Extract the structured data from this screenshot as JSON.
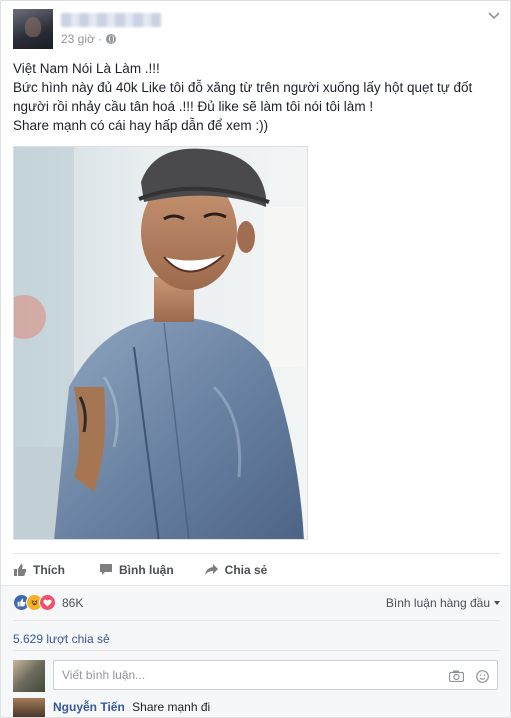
{
  "post": {
    "timestamp": "23 giờ ·",
    "lines": [
      "Việt Nam Nói Là Làm .!!!",
      "Bức hình này đủ 40k Like tôi đỗ xăng từ trên người xuống lấy hột quẹt tự đốt",
      "người rồi nhảy cầu tân hoá .!!! Đủ like sẽ làm tôi nói tôi làm !",
      "Share mạnh có cái hay hấp dẫn để xem :))"
    ]
  },
  "actions": {
    "like": "Thích",
    "comment": "Bình luận",
    "share": "Chia sẻ"
  },
  "reactions": {
    "count": "86K",
    "top_comments": "Bình luận hàng đầu",
    "shares": "5.629 lượt chia sẻ"
  },
  "comment_input": {
    "placeholder": "Viết bình luận..."
  },
  "comments": [
    {
      "author": "Nguyễn Tiến",
      "text": "Share mạnh đi"
    }
  ],
  "colors": {
    "link": "#365899",
    "like_blue": "#4267b2",
    "haha_yellow": "#f7b125",
    "love_red": "#f25268"
  }
}
